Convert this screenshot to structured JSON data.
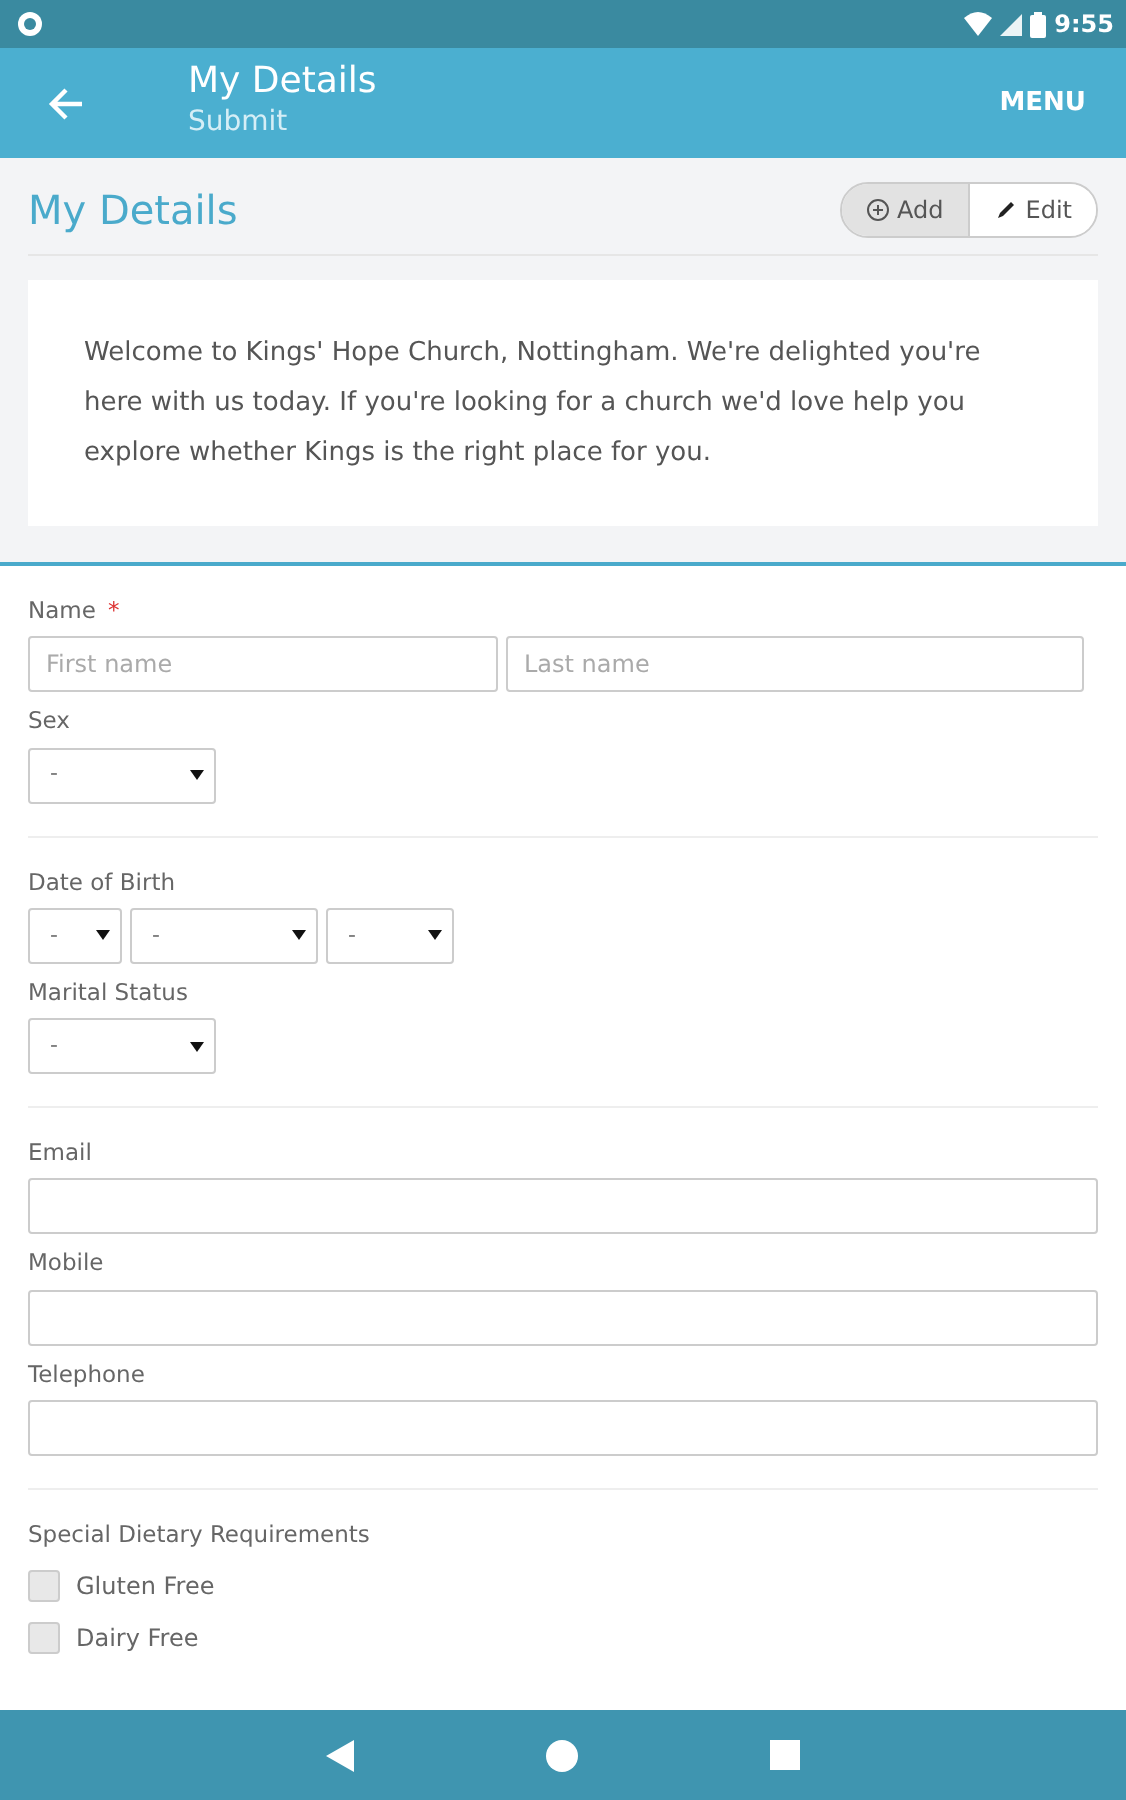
{
  "status_bar": {
    "time": "9:55"
  },
  "app_bar": {
    "title": "My Details",
    "subtitle": "Submit",
    "menu": "MENU"
  },
  "page": {
    "title": "My Details",
    "modes": [
      {
        "label": "Add",
        "selected": true
      },
      {
        "label": "Edit",
        "selected": false
      }
    ]
  },
  "welcome": "Welcome to Kings' Hope Church, Nottingham. We're delighted you're here with us today. If you're looking for a church we'd love help you explore whether Kings is the right place for you.",
  "sections": [
    {
      "fields": [
        {
          "kind": "name",
          "label": "Name",
          "required_marker": "*",
          "inputs": [
            {
              "placeholder": "First name"
            },
            {
              "placeholder": "Last name"
            }
          ]
        },
        {
          "kind": "select",
          "label": "Sex",
          "selects": [
            {
              "value": "-"
            }
          ]
        }
      ]
    },
    {
      "fields": [
        {
          "kind": "date",
          "label": "Date of Birth",
          "selects": [
            {
              "value": "-"
            },
            {
              "value": "-"
            },
            {
              "value": "-"
            }
          ]
        },
        {
          "kind": "select",
          "label": "Marital Status",
          "selects": [
            {
              "value": "-"
            }
          ]
        }
      ]
    },
    {
      "fields": [
        {
          "kind": "text",
          "label": "Email"
        },
        {
          "kind": "text",
          "label": "Mobile"
        },
        {
          "kind": "text",
          "label": "Telephone"
        }
      ]
    },
    {
      "fields": [
        {
          "kind": "checks",
          "label": "Special Dietary Requirements",
          "options": [
            {
              "label": "Gluten Free",
              "checked": false
            },
            {
              "label": "Dairy Free",
              "checked": false
            }
          ]
        }
      ]
    }
  ]
}
